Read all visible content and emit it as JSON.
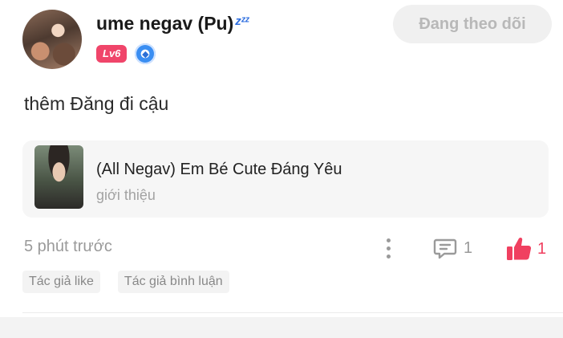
{
  "post": {
    "author": {
      "name": "ume negav (Pu)",
      "status_icon": "zzz-icon",
      "level": "Lv6",
      "badge_icon": "gem-icon"
    },
    "follow_label": "Đang theo dõi",
    "text": "thêm Đăng đi cậu",
    "linked_item": {
      "title": "(All Negav) Em Bé Cute Đáng Yêu",
      "subtitle": "giới thiệu"
    },
    "time": "5 phút trước",
    "comment_count": "1",
    "like_count": "1",
    "tags": [
      "Tác giả like",
      "Tác giả bình luận"
    ]
  },
  "colors": {
    "level_badge": "#f0456a",
    "like": "#f04060",
    "follow_button_bg": "#f0f0f0",
    "status_icon": "#2f6fe0"
  }
}
